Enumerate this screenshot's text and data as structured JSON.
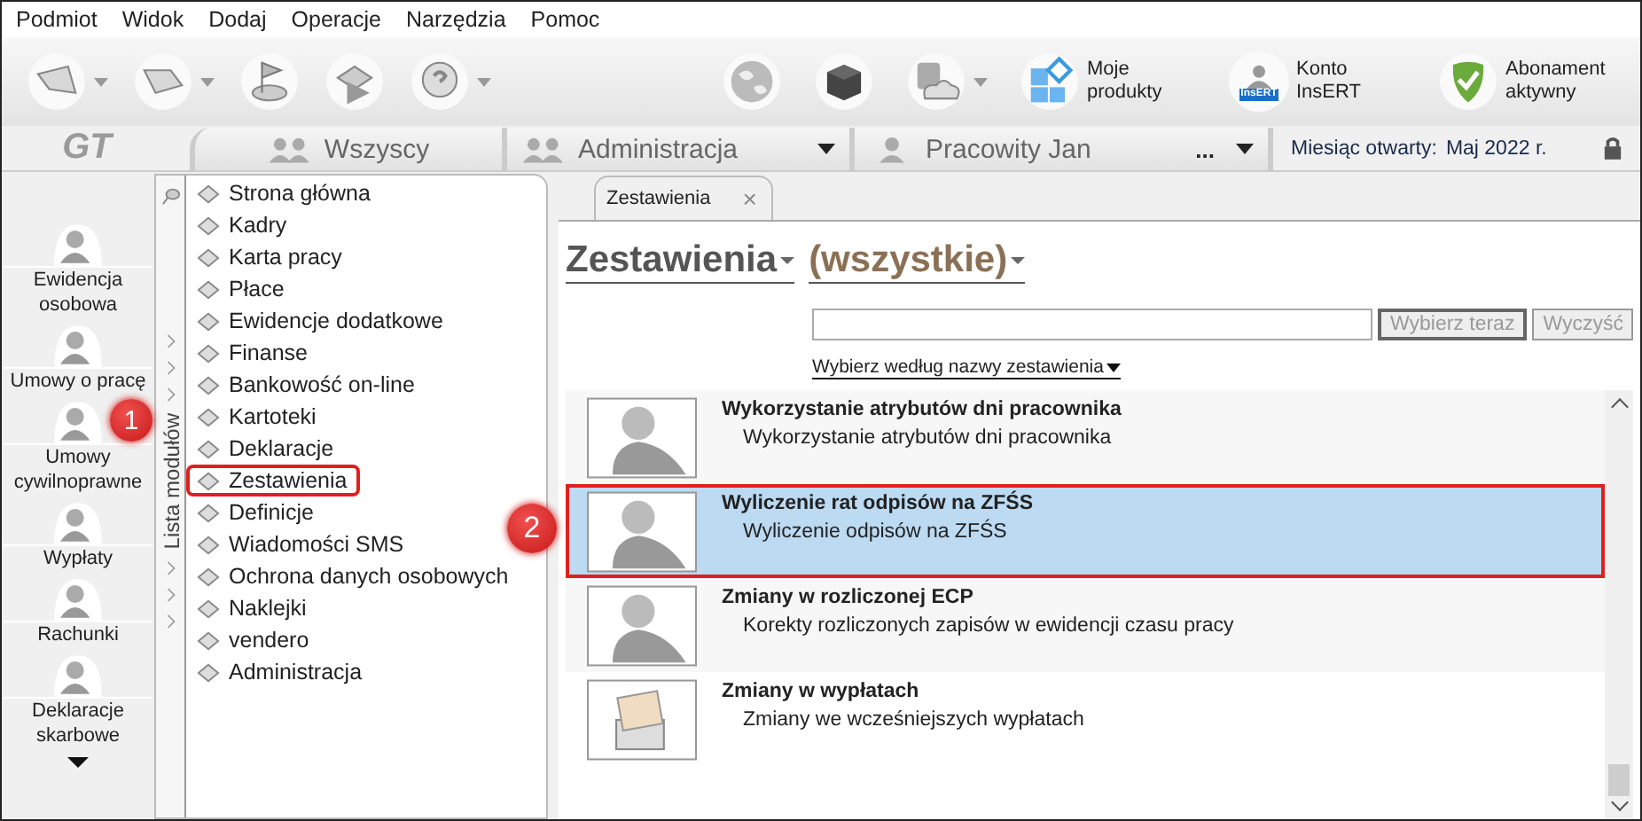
{
  "menu": [
    "Podmiot",
    "Widok",
    "Dodaj",
    "Operacje",
    "Narzędzia",
    "Pomoc"
  ],
  "toolbar_left": [
    {
      "kind": "back",
      "dropdown": true
    },
    {
      "kind": "forward",
      "dropdown": true
    },
    {
      "kind": "flag",
      "dropdown": false
    },
    {
      "kind": "check",
      "dropdown": false
    },
    {
      "kind": "help",
      "dropdown": true
    }
  ],
  "toolbar_right": [
    {
      "kind": "globe",
      "dropdown": false
    },
    {
      "kind": "cube",
      "dropdown": false
    },
    {
      "kind": "cloud",
      "dropdown": true
    },
    {
      "kind": "products",
      "label": "Moje produkty",
      "dropdown": false
    },
    {
      "kind": "account",
      "label": "Konto InsERT",
      "badge": "InsERT",
      "dropdown": false
    },
    {
      "kind": "shield",
      "label": "Abonament aktywny",
      "dropdown": false
    }
  ],
  "logo": "GT",
  "context_tabs": [
    {
      "label": "Wszyscy",
      "kind": "group"
    },
    {
      "label": "Administracja",
      "kind": "group",
      "dropdown": true
    },
    {
      "label": "Pracowity Jan",
      "kind": "person",
      "more": "...",
      "dropdown": true
    }
  ],
  "open_month": {
    "label": "Miesiąc otwarty:",
    "value": "Maj 2022 r."
  },
  "sidebar": {
    "items": [
      "Ewidencja osobowa",
      "Umowy o pracę",
      "Umowy cywilnoprawne",
      "Wypłaty",
      "Rachunki",
      "Deklaracje skarbowe"
    ]
  },
  "modules": {
    "title": "Lista modułów",
    "items": [
      {
        "label": "Strona główna",
        "highlighted": false
      },
      {
        "label": "Kadry",
        "highlighted": false
      },
      {
        "label": "Karta pracy",
        "highlighted": false
      },
      {
        "label": "Płace",
        "highlighted": false
      },
      {
        "label": "Ewidencje dodatkowe",
        "highlighted": false
      },
      {
        "label": "Finanse",
        "highlighted": false
      },
      {
        "label": "Bankowość on-line",
        "highlighted": false
      },
      {
        "label": "Kartoteki",
        "highlighted": false
      },
      {
        "label": "Deklaracje",
        "highlighted": false
      },
      {
        "label": "Zestawienia",
        "highlighted": true
      },
      {
        "label": "Definicje",
        "highlighted": false
      },
      {
        "label": "Wiadomości SMS",
        "highlighted": false
      },
      {
        "label": "Ochrona danych osobowych",
        "highlighted": false
      },
      {
        "label": "Naklejki",
        "highlighted": false
      },
      {
        "label": "vendero",
        "highlighted": false
      },
      {
        "label": "Administracja",
        "highlighted": false
      }
    ]
  },
  "doc_tab": {
    "label": "Zestawienia",
    "close": "×"
  },
  "heading": {
    "title": "Zestawienia",
    "filter": "(wszystkie)"
  },
  "search": {
    "button": "Wybierz teraz",
    "clear": "Wyczyść",
    "mode_link": "Wybierz według nazwy zestawienia"
  },
  "reports": [
    {
      "title": "Wykorzystanie atrybutów dni pracownika",
      "description": "Wykorzystanie atrybutów dni pracownika",
      "kind": "person",
      "selected": false,
      "highlighted": false
    },
    {
      "title": "Wyliczenie rat odpisów na ZFŚS",
      "description": "Wyliczenie odpisów na ZFŚS",
      "kind": "person",
      "selected": true,
      "highlighted": true
    },
    {
      "title": "Zmiany w rozliczonej ECP",
      "description": "Korekty rozliczonych zapisów w ewidencji czasu pracy",
      "kind": "person",
      "selected": false,
      "highlighted": false
    },
    {
      "title": "Zmiany w wypłatach",
      "description": "Zmiany we wcześniejszych wypłatach",
      "kind": "money",
      "selected": false,
      "highlighted": false
    }
  ],
  "callouts": [
    "1",
    "2"
  ]
}
